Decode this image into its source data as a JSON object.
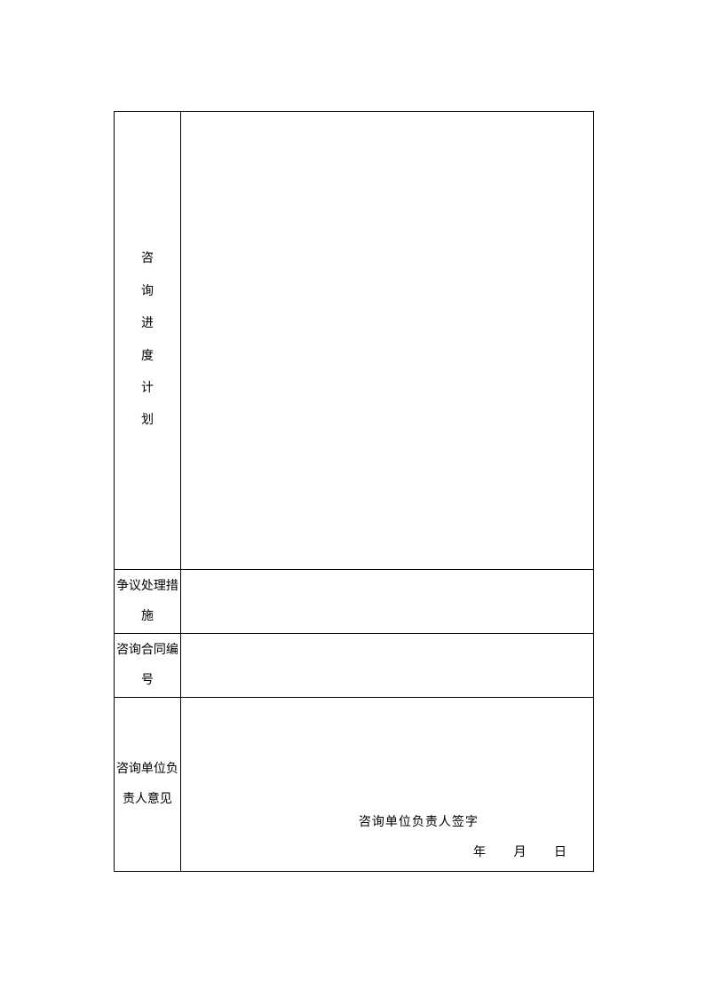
{
  "rows": {
    "plan": {
      "label_chars": [
        "咨",
        "询",
        "进",
        "度",
        "计",
        "划"
      ]
    },
    "dispute": {
      "label": "争议处理措施"
    },
    "contract": {
      "label": "咨询合同编号"
    },
    "opinion": {
      "label": "咨询单位负责人意见",
      "signature_label": "咨询单位负责人签字",
      "year": "年",
      "month": "月",
      "day": "日"
    }
  }
}
